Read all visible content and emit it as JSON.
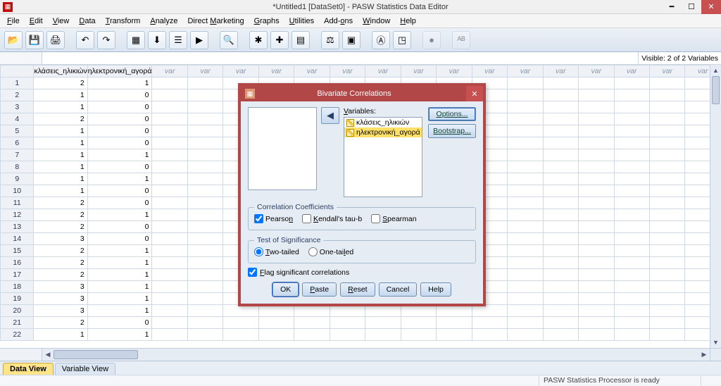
{
  "window": {
    "title": "*Untitled1 [DataSet0] - PASW Statistics Data Editor"
  },
  "menu": [
    "File",
    "Edit",
    "View",
    "Data",
    "Transform",
    "Analyze",
    "Direct Marketing",
    "Graphs",
    "Utilities",
    "Add-ons",
    "Window",
    "Help"
  ],
  "visible_label": "Visible: 2 of 2 Variables",
  "columns": {
    "c0": "κλάσεις_ηλικιών",
    "c1": "ηλεκτρονική_αγορά",
    "var": "var"
  },
  "rows": [
    {
      "n": "1",
      "a": "2",
      "b": "1"
    },
    {
      "n": "2",
      "a": "1",
      "b": "0"
    },
    {
      "n": "3",
      "a": "1",
      "b": "0"
    },
    {
      "n": "4",
      "a": "2",
      "b": "0"
    },
    {
      "n": "5",
      "a": "1",
      "b": "0"
    },
    {
      "n": "6",
      "a": "1",
      "b": "0"
    },
    {
      "n": "7",
      "a": "1",
      "b": "1"
    },
    {
      "n": "8",
      "a": "1",
      "b": "0"
    },
    {
      "n": "9",
      "a": "1",
      "b": "1"
    },
    {
      "n": "10",
      "a": "1",
      "b": "0"
    },
    {
      "n": "11",
      "a": "2",
      "b": "0"
    },
    {
      "n": "12",
      "a": "2",
      "b": "1"
    },
    {
      "n": "13",
      "a": "2",
      "b": "0"
    },
    {
      "n": "14",
      "a": "3",
      "b": "0"
    },
    {
      "n": "15",
      "a": "2",
      "b": "1"
    },
    {
      "n": "16",
      "a": "2",
      "b": "1"
    },
    {
      "n": "17",
      "a": "2",
      "b": "1"
    },
    {
      "n": "18",
      "a": "3",
      "b": "1"
    },
    {
      "n": "19",
      "a": "3",
      "b": "1"
    },
    {
      "n": "20",
      "a": "3",
      "b": "1"
    },
    {
      "n": "21",
      "a": "2",
      "b": "0"
    },
    {
      "n": "22",
      "a": "1",
      "b": "1"
    }
  ],
  "tabs": {
    "data_view": "Data View",
    "variable_view": "Variable View"
  },
  "status": {
    "processor": "PASW Statistics Processor is ready"
  },
  "dialog": {
    "title": "Bivariate Correlations",
    "vars_label": "Variables:",
    "var0": "κλάσεις_ηλικιών",
    "var1": "ηλεκτρονική_αγορά",
    "options": "Options...",
    "bootstrap": "Bootstrap...",
    "cc_legend": "Correlation Coefficients",
    "pearson": "Pearson",
    "kendall": "Kendall's tau-b",
    "spearman": "Spearman",
    "sig_legend": "Test of Significance",
    "two_tailed": "Two-tailed",
    "one_tailed": "One-tailed",
    "flag": "Flag significant correlations",
    "ok": "OK",
    "paste": "Paste",
    "reset": "Reset",
    "cancel": "Cancel",
    "help": "Help"
  }
}
